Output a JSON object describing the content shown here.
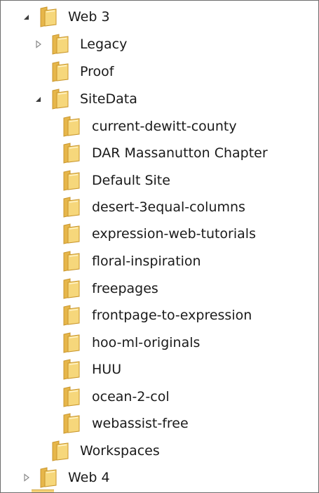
{
  "tree": {
    "items": [
      {
        "label": "Web 3",
        "expander": "expanded"
      },
      {
        "label": "Legacy",
        "expander": "collapsed"
      },
      {
        "label": "Proof",
        "expander": "none"
      },
      {
        "label": "SiteData",
        "expander": "expanded"
      },
      {
        "label": "current-dewitt-county",
        "expander": "none"
      },
      {
        "label": "DAR Massanutton Chapter",
        "expander": "none"
      },
      {
        "label": "Default Site",
        "expander": "none"
      },
      {
        "label": "desert-3equal-columns",
        "expander": "none"
      },
      {
        "label": "expression-web-tutorials",
        "expander": "none"
      },
      {
        "label": "floral-inspiration",
        "expander": "none"
      },
      {
        "label": "freepages",
        "expander": "none"
      },
      {
        "label": "frontpage-to-expression",
        "expander": "none"
      },
      {
        "label": "hoo-ml-originals",
        "expander": "none"
      },
      {
        "label": "HUU",
        "expander": "none"
      },
      {
        "label": "ocean-2-col",
        "expander": "none"
      },
      {
        "label": "webassist-free",
        "expander": "none"
      },
      {
        "label": "Workspaces",
        "expander": "none"
      },
      {
        "label": "Web 4",
        "expander": "collapsed"
      }
    ]
  },
  "icons": {
    "folder": "folder-icon",
    "expanded": "triangle-expanded-icon",
    "collapsed": "triangle-collapsed-icon"
  },
  "colors": {
    "folder_front": "#f6d77b",
    "folder_back": "#e6b64a",
    "folder_edge": "#c9962c",
    "text": "#1a1a1a",
    "expander_dark": "#3c3c3c",
    "expander_light": "#8a8a8a",
    "border": "#6e6e6e"
  }
}
